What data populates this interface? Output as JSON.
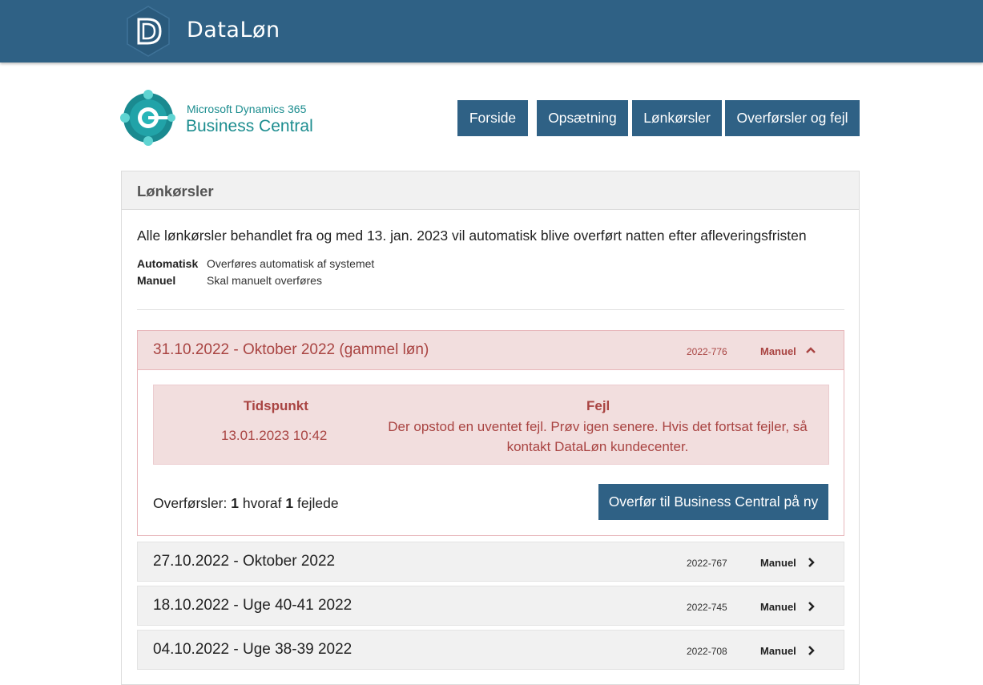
{
  "header": {
    "brand": "DataLøn",
    "logo_letter": "D"
  },
  "partner": {
    "line1": "Microsoft Dynamics 365",
    "line2": "Business Central"
  },
  "nav": [
    {
      "label": "Forside"
    },
    {
      "label": "Opsætning"
    },
    {
      "label": "Lønkørsler"
    },
    {
      "label": "Overførsler og fejl"
    }
  ],
  "panel": {
    "title": "Lønkørsler",
    "intro": "Alle lønkørsler behandlet fra og med 13. jan. 2023 vil automatisk blive overført natten efter afleveringsfristen",
    "legend": [
      {
        "key": "Automatisk",
        "value": "Overføres automatisk af systemet"
      },
      {
        "key": "Manuel",
        "value": "Skal manuelt overføres"
      }
    ]
  },
  "runs": [
    {
      "title": "31.10.2022 - Oktober 2022 (gammel løn)",
      "number": "2022-776",
      "mode": "Manuel",
      "expanded": true,
      "error": {
        "time_label": "Tidspunkt",
        "time_value": "13.01.2023 10:42",
        "error_label": "Fejl",
        "error_text": "Der opstod en uventet fejl. Prøv igen senere. Hvis det fortsat fejler, så kontakt DataLøn kundecenter."
      },
      "transfers": {
        "prefix": "Overførsler:",
        "count": "1",
        "mid": "hvoraf",
        "failed": "1",
        "suffix": "fejlede"
      },
      "retry_label": "Overfør til Business Central på ny"
    },
    {
      "title": "27.10.2022 - Oktober 2022",
      "number": "2022-767",
      "mode": "Manuel",
      "expanded": false
    },
    {
      "title": "18.10.2022 - Uge 40-41 2022",
      "number": "2022-745",
      "mode": "Manuel",
      "expanded": false
    },
    {
      "title": "04.10.2022 - Uge 38-39 2022",
      "number": "2022-708",
      "mode": "Manuel",
      "expanded": false
    }
  ],
  "colors": {
    "primary": "#2f6185",
    "error_bg": "#f2dede",
    "error_text": "#a94442",
    "teal": "#1c8d8f"
  }
}
